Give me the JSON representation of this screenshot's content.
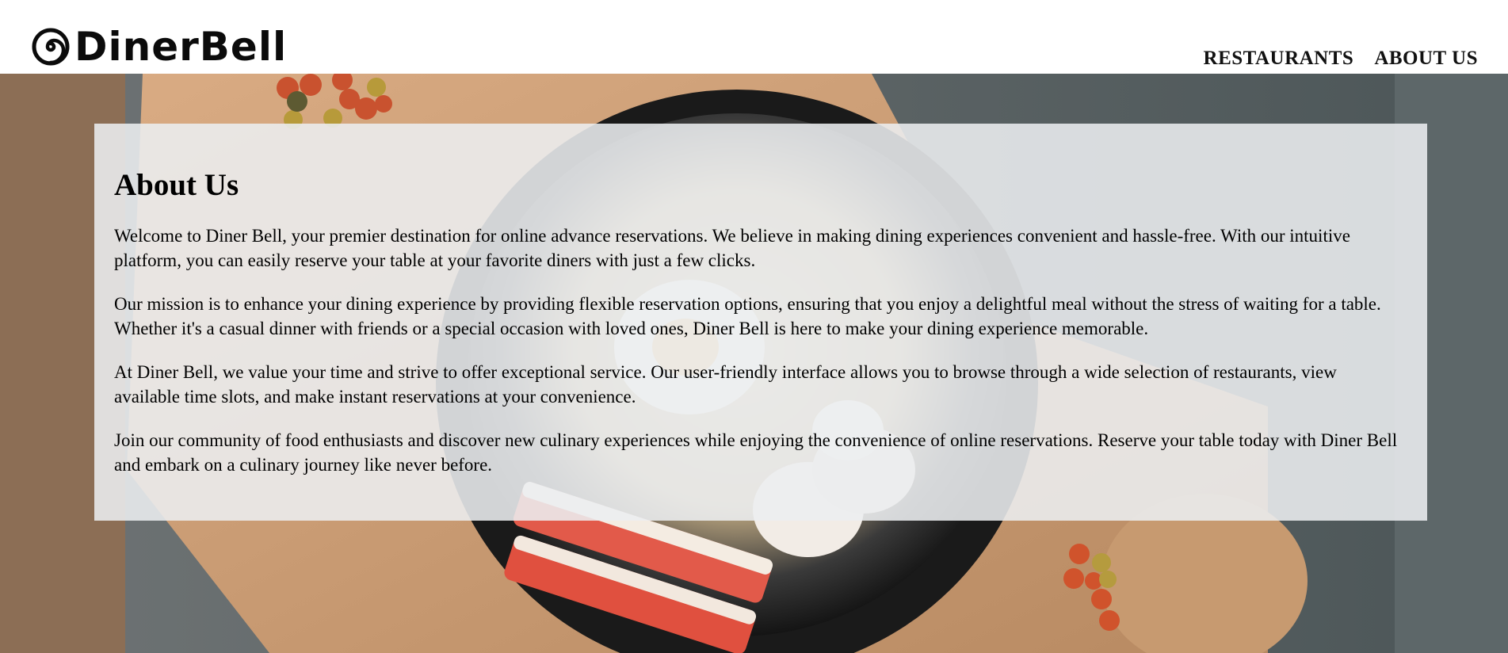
{
  "header": {
    "brand": "DinerBell",
    "logo_icon": "spiral-logo-icon",
    "nav": [
      {
        "label": "RESTAURANTS"
      },
      {
        "label": "ABOUT US"
      }
    ]
  },
  "hero": {
    "image": "bowl-of-noodles-with-crab-sticks-mushrooms-and-egg-on-wooden-board"
  },
  "about": {
    "title": "About Us",
    "paragraphs": [
      "Welcome to Diner Bell, your premier destination for online advance reservations. We believe in making dining experiences convenient and hassle-free. With our intuitive platform, you can easily reserve your table at your favorite diners with just a few clicks.",
      "Our mission is to enhance your dining experience by providing flexible reservation options, ensuring that you enjoy a delightful meal without the stress of waiting for a table. Whether it's a casual dinner with friends or a special occasion with loved ones, Diner Bell is here to make your dining experience memorable.",
      "At Diner Bell, we value your time and strive to offer exceptional service. Our user-friendly interface allows you to browse through a wide selection of restaurants, view available time slots, and make instant reservations at your convenience.",
      "Join our community of food enthusiasts and discover new culinary experiences while enjoying the convenience of online reservations. Reserve your table today with Diner Bell and embark on a culinary journey like never before."
    ]
  },
  "colors": {
    "header_bg": "#ffffff",
    "card_bg": "#eceef0",
    "text": "#000000"
  }
}
